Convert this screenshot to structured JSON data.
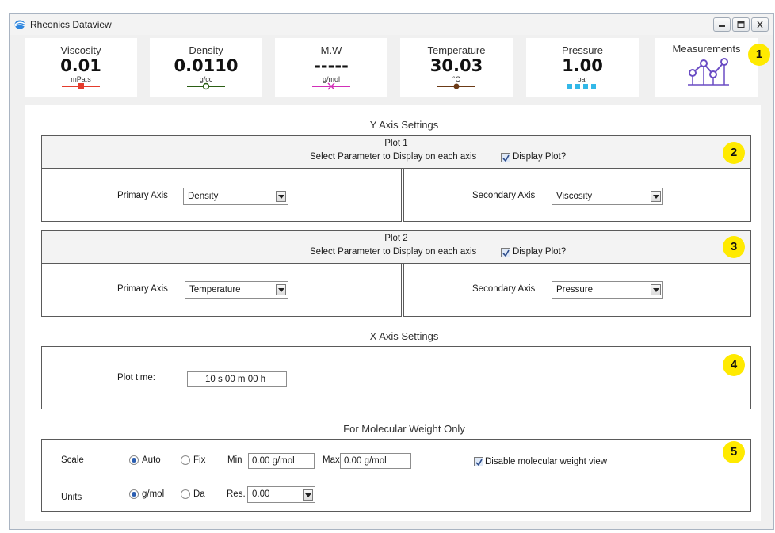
{
  "window": {
    "title": "Rheonics Dataview"
  },
  "measurements": [
    {
      "label": "Viscosity",
      "value": "0.01",
      "unit": "mPa.s",
      "color": "#e43b2c"
    },
    {
      "label": "Density",
      "value": "0.0110",
      "unit": "g/cc",
      "color": "#2b5e14"
    },
    {
      "label": "M.W",
      "value": "-----",
      "unit": "g/mol",
      "color": "#d12fb8"
    },
    {
      "label": "Temperature",
      "value": "30.03",
      "unit": "°C",
      "color": "#6b3a16"
    },
    {
      "label": "Pressure",
      "value": "1.00",
      "unit": "bar",
      "color": "#33b8e8"
    },
    {
      "label": "Measurements",
      "color": "#6a4cc4"
    }
  ],
  "badges": [
    "1",
    "2",
    "3",
    "4",
    "5"
  ],
  "y_axis": {
    "title": "Y Axis Settings",
    "plots": [
      {
        "name": "Plot 1",
        "subtitle": "Select Parameter to Display on each axis",
        "display_label": "Display Plot?",
        "display_checked": true,
        "primary_label": "Primary Axis",
        "primary_value": "Density",
        "secondary_label": "Secondary Axis",
        "secondary_value": "Viscosity"
      },
      {
        "name": "Plot 2",
        "subtitle": "Select Parameter to Display on each axis",
        "display_label": "Display Plot?",
        "display_checked": true,
        "primary_label": "Primary Axis",
        "primary_value": "Temperature",
        "secondary_label": "Secondary Axis",
        "secondary_value": "Pressure"
      }
    ]
  },
  "x_axis": {
    "title": "X Axis Settings",
    "plot_time_label": "Plot time:",
    "plot_time_value": "10 s 00 m 00 h"
  },
  "mw": {
    "title": "For Molecular Weight Only",
    "scale_label": "Scale",
    "auto_label": "Auto",
    "fix_label": "Fix",
    "scale_selected": "Auto",
    "min_label": "Min",
    "min_value": "0.00 g/mol",
    "max_label": "Max",
    "max_value": "0.00 g/mol",
    "disable_label": "Disable molecular weight view",
    "disable_checked": true,
    "units_label": "Units",
    "gmol_label": "g/mol",
    "da_label": "Da",
    "units_selected": "g/mol",
    "res_label": "Res.",
    "res_value": "0.00"
  }
}
